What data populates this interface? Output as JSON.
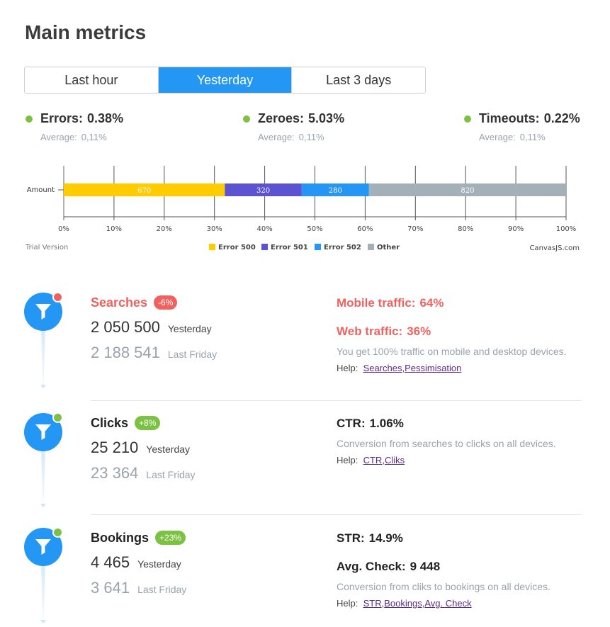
{
  "page": {
    "title": "Main metrics",
    "colors": {
      "accent": "#2496f3",
      "positive": "#7cc242",
      "negative": "#f0625f",
      "muted": "#9aa3ad"
    }
  },
  "tabs": [
    {
      "label": "Last hour",
      "active": false
    },
    {
      "label": "Yesterday",
      "active": true
    },
    {
      "label": "Last 3 days",
      "active": false
    }
  ],
  "kpis": [
    {
      "label": "Errors:",
      "value": "0.38%",
      "avg_label": "Average:",
      "avg_value": "0,11%",
      "status": "green"
    },
    {
      "label": "Zeroes:",
      "value": "5.03%",
      "avg_label": "Average:",
      "avg_value": "0,11%",
      "status": "green"
    },
    {
      "label": "Timeouts:",
      "value": "0.22%",
      "avg_label": "Average:",
      "avg_value": "0,11%",
      "status": "green"
    }
  ],
  "chart_data": {
    "type": "bar",
    "orientation": "horizontal",
    "stacking": "100%",
    "categories": [
      "Amount"
    ],
    "series": [
      {
        "name": "Error 500",
        "values": [
          670
        ],
        "color": "#ffcc00"
      },
      {
        "name": "Error 501",
        "values": [
          320
        ],
        "color": "#5b53d1"
      },
      {
        "name": "Error 502",
        "values": [
          280
        ],
        "color": "#2496f3"
      },
      {
        "name": "Other",
        "values": [
          820
        ],
        "color": "#a3b0b8"
      }
    ],
    "x_ticks": [
      "0%",
      "10%",
      "20%",
      "30%",
      "40%",
      "50%",
      "60%",
      "70%",
      "80%",
      "90%",
      "100%"
    ],
    "xlim": [
      0,
      100
    ],
    "grid": true,
    "legend_position": "bottom",
    "watermark_left": "Trial Version",
    "credit_right": "CanvasJS.com"
  },
  "sections": [
    {
      "title": "Searches",
      "title_color": "red",
      "badge": "-6%",
      "badge_color": "red",
      "status": "red",
      "current_value": "2 050 500",
      "current_label": "Yesterday",
      "previous_value": "2 188 541",
      "previous_label": "Last Friday",
      "metrics": [
        {
          "label": "Mobile traffic:",
          "value": "64%",
          "color": "red"
        },
        {
          "label": "Web traffic:",
          "value": "36%",
          "color": "red"
        }
      ],
      "description": "You get 100% traffic on mobile and desktop devices.",
      "help_label": "Help:",
      "help_links": [
        "Searches",
        "Pessimisation"
      ]
    },
    {
      "title": "Clicks",
      "title_color": "dark",
      "badge": "+8%",
      "badge_color": "green",
      "status": "green",
      "current_value": "25 210",
      "current_label": "Yesterday",
      "previous_value": "23 364",
      "previous_label": "Last Friday",
      "metrics": [
        {
          "label": "CTR:",
          "value": "1.06%",
          "color": "dark"
        }
      ],
      "description": "Conversion from searches to clicks on all devices.",
      "help_label": "Help:",
      "help_links": [
        "CTR",
        "Cliks"
      ]
    },
    {
      "title": "Bookings",
      "title_color": "dark",
      "badge": "+23%",
      "badge_color": "green",
      "status": "green",
      "current_value": "4 465",
      "current_label": "Yesterday",
      "previous_value": "3 641",
      "previous_label": "Last Friday",
      "metrics": [
        {
          "label": "STR:",
          "value": "14.9%",
          "color": "dark"
        },
        {
          "label": "Avg. Check:",
          "value": "9 448",
          "color": "dark"
        }
      ],
      "description": "Conversion from cliks to bookings on all devices.",
      "help_label": "Help:",
      "help_links": [
        "STR",
        "Bookings",
        "Avg. Check"
      ]
    }
  ],
  "icons": {
    "section_pin": "filter-icon"
  }
}
